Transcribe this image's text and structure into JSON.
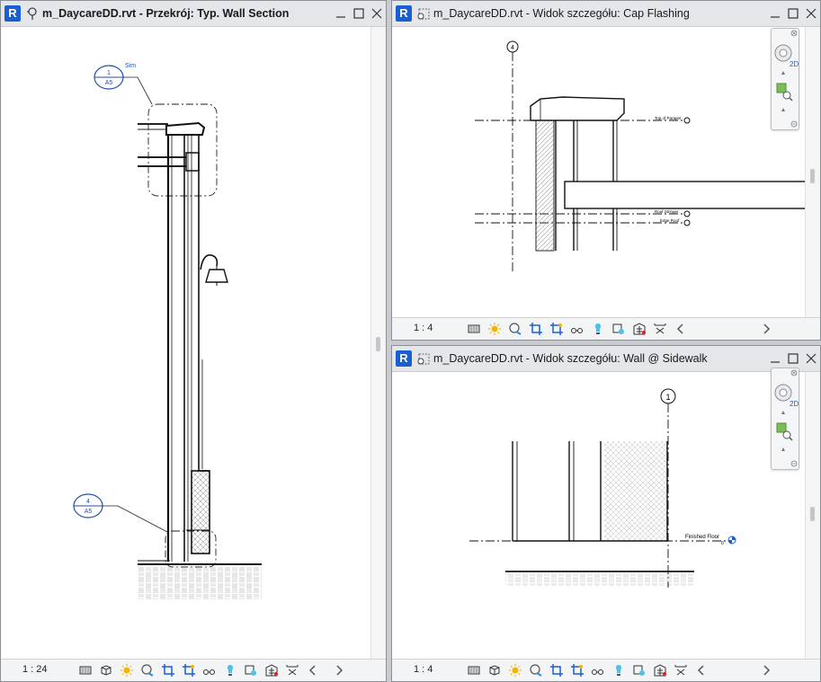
{
  "windows": {
    "section": {
      "title": "m_DaycareDD.rvt - Przekrój: Typ. Wall Section",
      "scale": "1 : 24",
      "callout_top": {
        "number": "1",
        "sheet": "A5",
        "note": "Sim"
      },
      "callout_bottom": {
        "number": "4",
        "sheet": "A5"
      }
    },
    "cap": {
      "title": "m_DaycareDD.rvt - Widok szczegółu: Cap Flashing",
      "scale": "1 : 4",
      "grid_label": "4",
      "levels": [
        "Top of Parapet",
        "Roof Stringer",
        "Edge Roof"
      ]
    },
    "sidewalk": {
      "title": "m_DaycareDD.rvt - Widok szczegółu: Wall @ Sidewalk",
      "scale": "1 : 4",
      "grid_label": "1",
      "level": {
        "name": "Finished Floor",
        "value": "0"
      }
    }
  },
  "navbar": {
    "steering_label": "2D"
  },
  "colors": {
    "revit_blue": "#1a5fd1",
    "callout_blue": "#1f4fa8",
    "titlebar": "#e4e6ea"
  }
}
